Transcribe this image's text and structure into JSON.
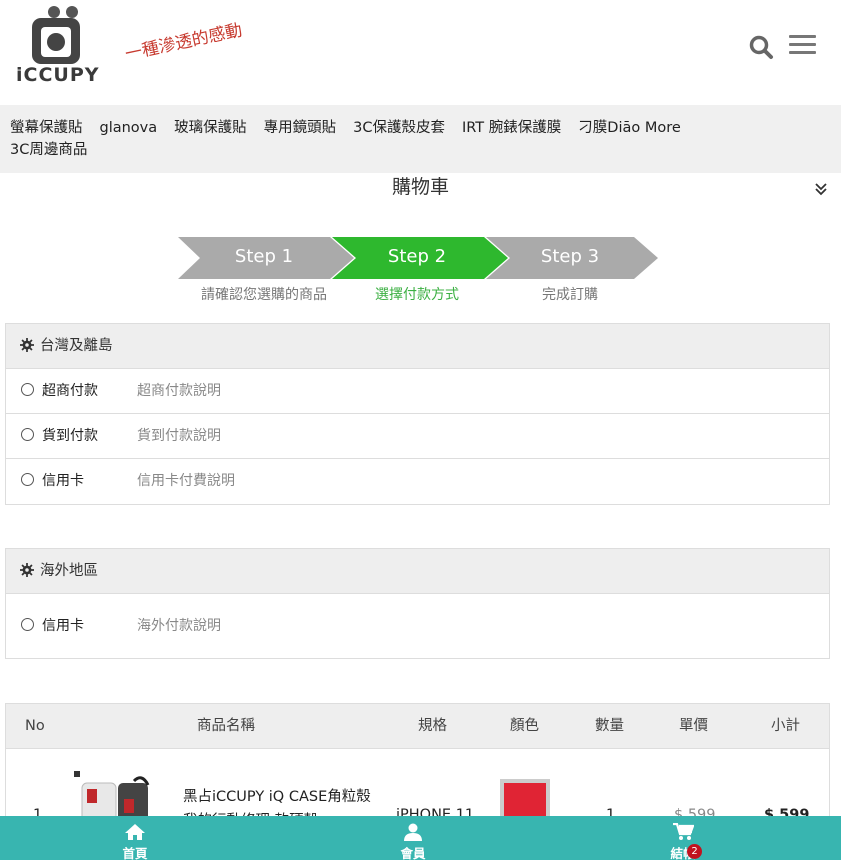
{
  "brand": {
    "logo_text": "iCCUPY",
    "slogan": "一種滲透的感動"
  },
  "nav": {
    "items": [
      "螢幕保護貼",
      "glanova",
      "玻璃保護貼",
      "專用鏡頭貼",
      "3C保護殼皮套",
      "IRT 腕錶保護膜",
      "刁膜Diāo More",
      "3C周邊商品"
    ]
  },
  "page": {
    "title": "購物車"
  },
  "steps": [
    {
      "label": "Step 1",
      "sub": "請確認您選購的商品",
      "color": "#aaaaaa"
    },
    {
      "label": "Step 2",
      "sub": "選擇付款方式",
      "color": "#2eb82e"
    },
    {
      "label": "Step 3",
      "sub": "完成訂購",
      "color": "#aaaaaa"
    }
  ],
  "payment": {
    "domestic": {
      "title": "台灣及離島",
      "options": [
        {
          "method": "超商付款",
          "desc": "超商付款說明"
        },
        {
          "method": "貨到付款",
          "desc": "貨到付款說明"
        },
        {
          "method": "信用卡",
          "desc": "信用卡付費說明"
        }
      ]
    },
    "overseas": {
      "title": "海外地區",
      "options": [
        {
          "method": "信用卡",
          "desc": "海外付款說明"
        }
      ]
    }
  },
  "table": {
    "headers": [
      "No",
      "商品名稱",
      "規格",
      "顏色",
      "數量",
      "單價",
      "小計"
    ],
    "rows": [
      {
        "no": "1",
        "name_line1": "黑占iCCUPY iQ CASE角粒殼",
        "name_line2": "我的行動修理 軟硬殼",
        "spec": "iPHONE 11",
        "color": "#e02434",
        "qty": "1",
        "price": "$ 599",
        "subtotal": "$ 599"
      }
    ]
  },
  "bottombar": {
    "home": "首頁",
    "member": "會員",
    "checkout": "結帳",
    "cart_count": "2"
  },
  "colors": {
    "accent": "#38b5b0",
    "step_active": "#2eb82e",
    "step_inactive": "#aaaaaa",
    "badge": "#c1121f"
  }
}
